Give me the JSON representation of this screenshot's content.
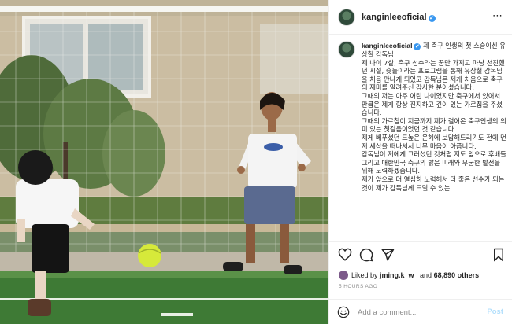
{
  "post": {
    "username": "kanginleeoficial",
    "verified_mark": "✔",
    "more_icon": "⋯",
    "caption_lines": [
      "제 축구 인생의 첫 스승이신 유상철 감독님",
      "제 나이 7살, 축구 선수라는 꿈만 가지고 마냥 천진했던 시절, 슛돌이라는 프로그램을 통해 유상철 감독님을 처음 만나게 되었고 감독님은 제게 처음으로 축구의 재미를 알려주신 감사한 분이셨습니다.",
      "그때의 저는 아주 어린 나이였지만 축구에서 있어서 만큼은 제게 항상 진지하고 깊이 있는 가르침을 주셨습니다.",
      "그때의 가르침이 지금까지 제가 걸어온 축구인생의 의미 있는 첫걸음이었던 것 같습니다.",
      "제게 베푸셨던 드높은 은혜에 보답해드리기도 전에 먼저 세상을 떠나셔서 너무 마음이 아픕니다.",
      "감독님이 저에게 그러셨던 것처럼 저도 앞으로 후배들 그리고 대한민국 축구의 밝은 미래와 무궁한 발전을 위해 노력하겠습니다.",
      "제가 앞으로 더 열심히 노력해서 더 좋은 선수가 되는 것이 제가 감독님께 드릴 수 있는"
    ],
    "liked_by_prefix": "Liked by ",
    "liked_by_user": "jming.k_w_",
    "liked_by_and": " and ",
    "liked_by_count": "68,890 others",
    "timestamp": "5 HOURS AGO",
    "comment_placeholder": "Add a comment...",
    "post_label": "Post",
    "icons": [
      "heart-icon",
      "comment-icon",
      "share-icon",
      "bookmark-icon",
      "emoji-icon"
    ]
  }
}
